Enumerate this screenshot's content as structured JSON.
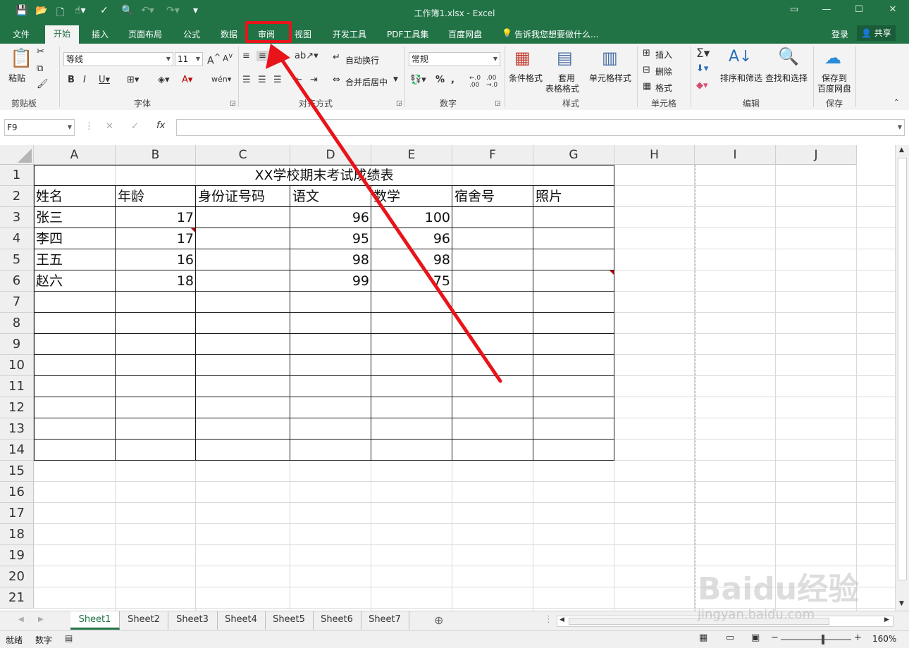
{
  "window": {
    "title": "工作簿1.xlsx - Excel",
    "login": "登录",
    "share": "共享"
  },
  "tabs": [
    "文件",
    "开始",
    "插入",
    "页面布局",
    "公式",
    "数据",
    "审阅",
    "视图",
    "开发工具",
    "PDF工具集",
    "百度网盘"
  ],
  "tell_me": "告诉我您想要做什么...",
  "ribbon": {
    "paste": "粘贴",
    "clipboard": "剪贴板",
    "font_name": "等线",
    "font_size": "11",
    "font_group": "字体",
    "wrap_text": "自动换行",
    "merge_center": "合并后居中",
    "align_group": "对齐方式",
    "number_format": "常规",
    "number_group": "数字",
    "cond_format": "条件格式",
    "table_format_1": "套用",
    "table_format_2": "表格格式",
    "cell_style": "单元格样式",
    "styles_group": "样式",
    "insert": "插入",
    "delete": "删除",
    "format": "格式",
    "cells_group": "单元格",
    "sort_filter": "排序和筛选",
    "find_select": "查找和选择",
    "edit_group": "编辑",
    "save_to_1": "保存到",
    "save_to_2": "百度网盘",
    "save_group": "保存"
  },
  "formula_bar": {
    "name_box": "F9",
    "fx": "fx",
    "content": ""
  },
  "columns": [
    "A",
    "B",
    "C",
    "D",
    "E",
    "F",
    "G",
    "H",
    "I",
    "J"
  ],
  "rows": [
    "1",
    "2",
    "3",
    "4",
    "5",
    "6",
    "7",
    "8",
    "9",
    "10",
    "11",
    "12",
    "13",
    "14",
    "15",
    "16",
    "17",
    "18",
    "19",
    "20",
    "21"
  ],
  "sheet": {
    "title": "XX学校期末考试成绩表",
    "headers": [
      "姓名",
      "年龄",
      "身份证号码",
      "语文",
      "数学",
      "宿舍号",
      "照片"
    ],
    "data": [
      [
        "张三",
        "17",
        "",
        "96",
        "100",
        "",
        ""
      ],
      [
        "李四",
        "17",
        "",
        "95",
        "96",
        "",
        ""
      ],
      [
        "王五",
        "16",
        "",
        "98",
        "98",
        "",
        ""
      ],
      [
        "赵六",
        "18",
        "",
        "99",
        "75",
        "",
        ""
      ]
    ]
  },
  "sheet_tabs": [
    "Sheet1",
    "Sheet2",
    "Sheet3",
    "Sheet4",
    "Sheet5",
    "Sheet6",
    "Sheet7"
  ],
  "active_sheet": "Sheet1",
  "status": {
    "ready": "就绪",
    "num": "数字",
    "zoom": "160%"
  },
  "watermark": {
    "logo": "Baidu经验",
    "url": "jingyan.baidu.com"
  },
  "colors": {
    "excel_green": "#217346",
    "highlight_red": "#e8141a"
  }
}
